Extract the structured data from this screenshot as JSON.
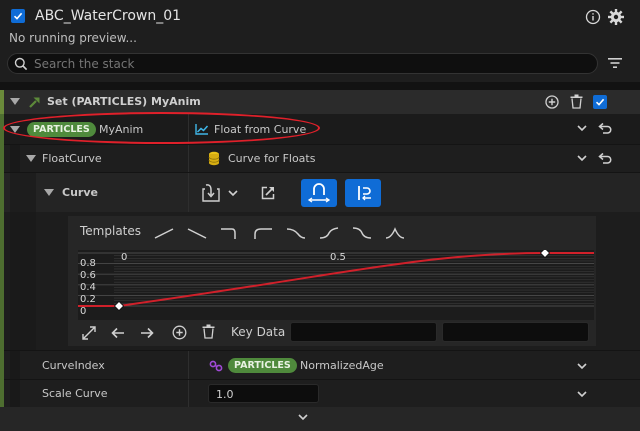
{
  "header": {
    "title": "ABC_WaterCrown_01",
    "subtitle": "No running preview..."
  },
  "search": {
    "placeholder": "Search the stack"
  },
  "module": {
    "title": "Set (PARTICLES) MyAnim"
  },
  "param_row": {
    "namespace": "PARTICLES",
    "name": "MyAnim",
    "value": "Float from Curve"
  },
  "floatcurve_row": {
    "label": "FloatCurve",
    "value": "Curve for Floats"
  },
  "curve_row": {
    "label": "Curve"
  },
  "templates": {
    "label": "Templates",
    "count": 8
  },
  "graph": {
    "x_labels": [
      "0",
      "0.5"
    ],
    "y_labels": [
      "0.8",
      "0.6",
      "0.4",
      "0.2",
      "0"
    ],
    "keys": [
      {
        "time": 0.0,
        "value": 0.0
      },
      {
        "time": 1.0,
        "value": 1.0
      }
    ],
    "curve_color": "#d0202a"
  },
  "key_data": {
    "label": "Key Data",
    "time": "",
    "value": ""
  },
  "curveindex_row": {
    "label": "CurveIndex",
    "namespace": "PARTICLES",
    "value": "NormalizedAge"
  },
  "scalecurve_row": {
    "label": "Scale Curve",
    "value": "1.0"
  },
  "colors": {
    "accent": "#0f6cd6",
    "namespace_pill": "#4f8a3c",
    "highlight": "#e0202a",
    "module_bar": "#6a8a3a"
  }
}
